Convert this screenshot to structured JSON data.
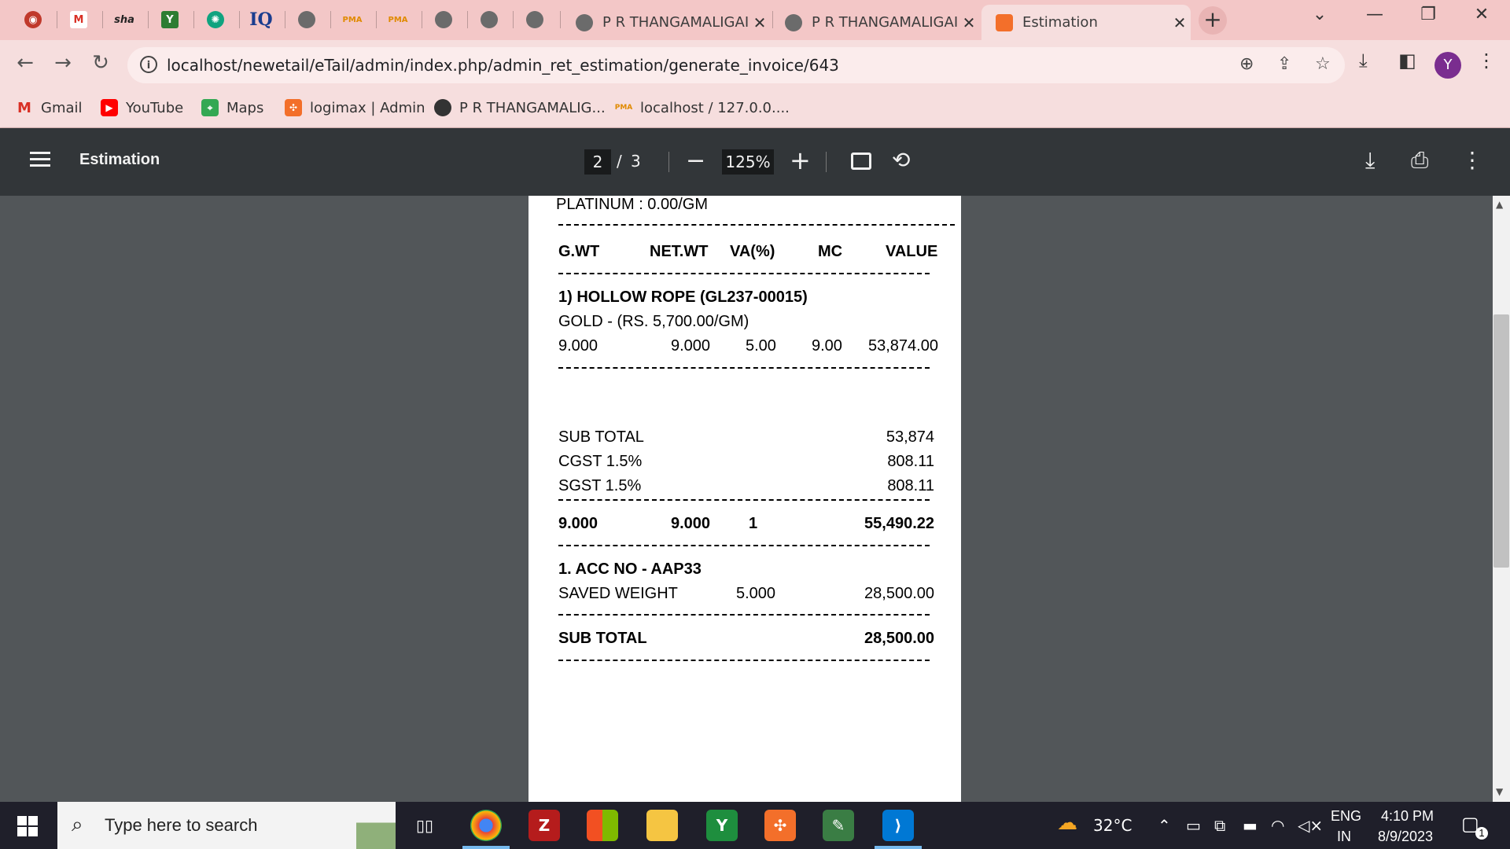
{
  "browser": {
    "tabs": [
      {
        "title": "P R THANGAMALIGAI",
        "close": "✕"
      },
      {
        "title": "P R THANGAMALIGAI",
        "close": "✕"
      },
      {
        "title": "Estimation",
        "close": "✕"
      }
    ],
    "pinned_icons": [
      "app-icon",
      "gmail-icon",
      "sha-icon",
      "y-icon",
      "chatgpt-icon",
      "iq-icon",
      "globe-icon",
      "pma-icon",
      "pma-icon",
      "globe-icon",
      "globe-icon",
      "globe-icon"
    ],
    "new_tab": "+",
    "url": "localhost/newetail/eTail/admin/index.php/admin_ret_estimation/generate_invoice/643",
    "profile_initial": "Y",
    "bookmarks": [
      "Gmail",
      "YouTube",
      "Maps",
      "logimax | Admin",
      "P R THANGAMALIG...",
      "localhost / 127.0.0...."
    ]
  },
  "pdf_viewer": {
    "title": "Estimation",
    "current_page": "2",
    "page_separator": "/",
    "total_pages": "3",
    "zoom": "125%"
  },
  "document": {
    "page1": {
      "platinum_rate": "PLATINUM   : 0.00/GM",
      "headers": [
        "G.WT",
        "NET.WT",
        "VA(%)",
        "MC",
        "VALUE"
      ],
      "item_title": "1) HOLLOW ROPE (GL237-00015)",
      "item_rate": "GOLD - (RS. 5,700.00/GM)",
      "item_values": [
        "9.000",
        "9.000",
        "5.00",
        "9.00",
        "53,874.00"
      ]
    },
    "page2": {
      "summary": [
        {
          "label": "SUB TOTAL",
          "value": "53,874"
        },
        {
          "label": "CGST 1.5%",
          "value": "808.11"
        },
        {
          "label": "SGST 1.5%",
          "value": "808.11"
        }
      ],
      "totals": [
        "9.000",
        "9.000",
        "1",
        "55,490.22"
      ],
      "acc_title": "1. ACC NO - AAP33",
      "saved_label": "SAVED WEIGHT",
      "saved_weight": "5.000",
      "saved_value": "28,500.00",
      "sub_total_label": "SUB TOTAL",
      "sub_total_value": "28,500.00"
    }
  },
  "taskbar": {
    "search_placeholder": "Type here to search",
    "weather": "32°C",
    "language": "ENG",
    "region": "IN",
    "time": "4:10 PM",
    "date": "8/9/2023",
    "notification_count": "1"
  }
}
